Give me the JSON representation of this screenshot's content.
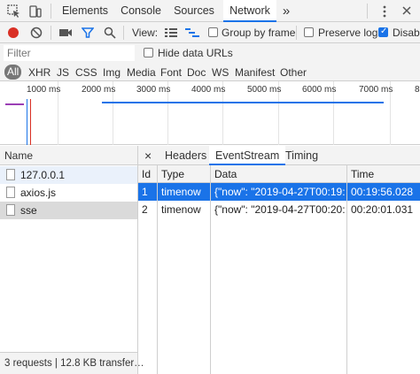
{
  "tabs": [
    {
      "label": "Elements"
    },
    {
      "label": "Console"
    },
    {
      "label": "Sources"
    },
    {
      "label": "Network"
    }
  ],
  "more_tabs_glyph": "»",
  "toolbar": {
    "view_label": "View:",
    "group_by_frame": {
      "label": "Group by frame",
      "checked": false
    },
    "preserve_log": {
      "label": "Preserve log",
      "checked": false
    },
    "disable_cache": {
      "label": "Disabl",
      "checked": true
    }
  },
  "filter": {
    "placeholder": "Filter",
    "hide_data_urls": {
      "label": "Hide data URLs",
      "checked": false
    }
  },
  "types": [
    "All",
    "XHR",
    "JS",
    "CSS",
    "Img",
    "Media",
    "Font",
    "Doc",
    "WS",
    "Manifest",
    "Other"
  ],
  "timeline": {
    "ticks": [
      "1000 ms",
      "2000 ms",
      "3000 ms",
      "4000 ms",
      "5000 ms",
      "6000 ms",
      "7000 ms",
      "8"
    ]
  },
  "requests": {
    "header": "Name",
    "items": [
      {
        "name": "127.0.0.1"
      },
      {
        "name": "axios.js"
      },
      {
        "name": "sse"
      }
    ],
    "status": "3 requests | 12.8 KB transfer…"
  },
  "details": {
    "close_glyph": "×",
    "tabs": [
      "Headers",
      "EventStream",
      "Timing"
    ],
    "columns": [
      "Id",
      "Type",
      "Data",
      "Time"
    ],
    "events": [
      {
        "id": "1",
        "type": "timenow",
        "data": "{\"now\": \"2019-04-27T00:19:…",
        "time": "00:19:56.028"
      },
      {
        "id": "2",
        "type": "timenow",
        "data": "{\"now\": \"2019-04-27T00:20:…",
        "time": "00:20:01.031"
      }
    ]
  },
  "colors": {
    "accent": "#1a73e8",
    "record": "#d93025"
  }
}
